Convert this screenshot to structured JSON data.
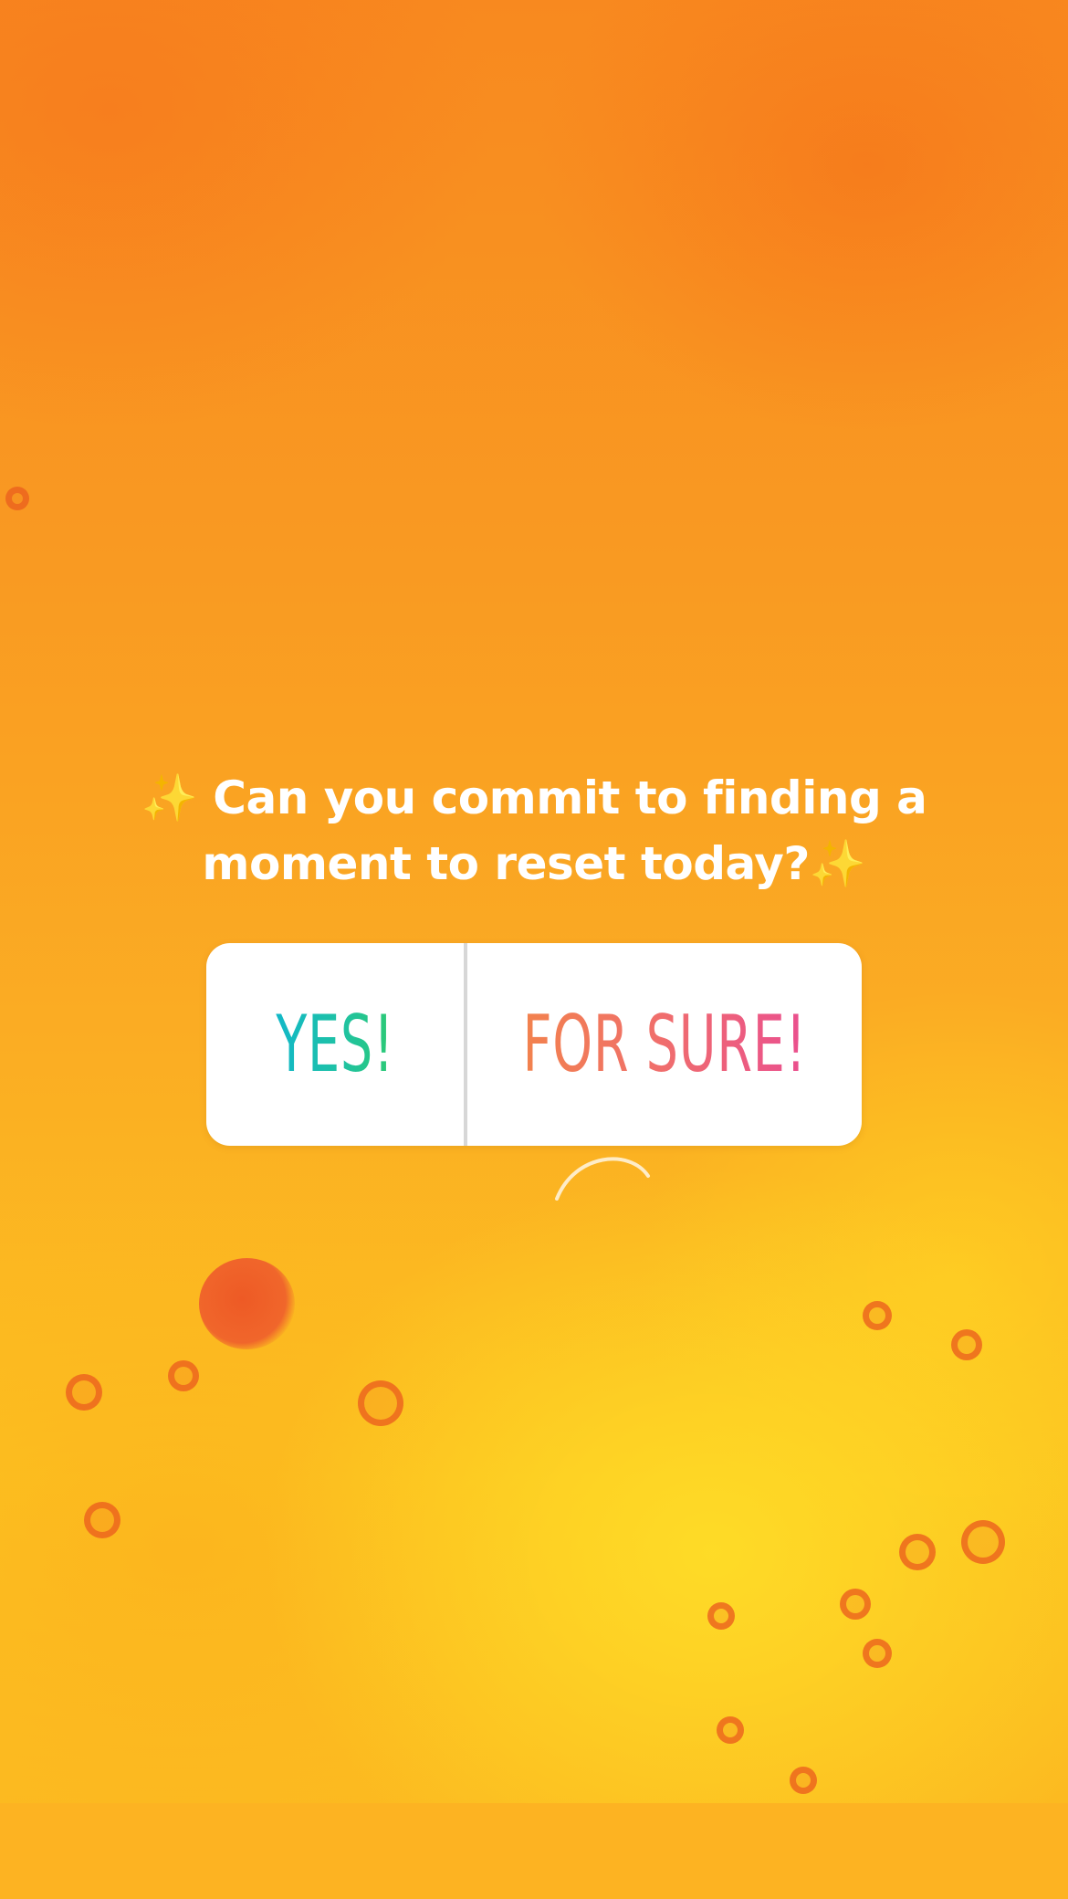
{
  "story": {
    "background_color": "#f99a22",
    "accent_colors": [
      "#f8891f",
      "#fcc21f",
      "#ee5a25"
    ]
  },
  "question": {
    "line1": "Can you commit to finding a",
    "line2": "moment to reset today?",
    "sparkle": "✨"
  },
  "poll": {
    "options": [
      {
        "label": "YES!"
      },
      {
        "label": "FOR SURE!"
      }
    ]
  }
}
